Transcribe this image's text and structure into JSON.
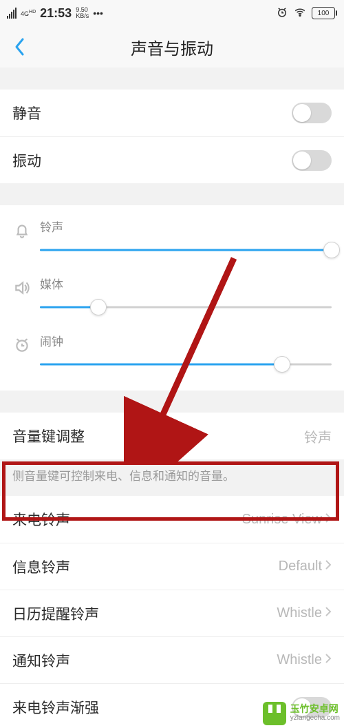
{
  "statusbar": {
    "net_gen": "4G",
    "net_sub": "HD",
    "time": "21:53",
    "speed_top": "9.50",
    "speed_unit": "KB/s",
    "dots": "•••",
    "battery": "100"
  },
  "header": {
    "title": "声音与振动"
  },
  "toggles": {
    "silent": {
      "label": "静音",
      "on": false
    },
    "vibrate": {
      "label": "振动",
      "on": false
    }
  },
  "volumes": {
    "ringtone": {
      "label": "铃声",
      "value": 100
    },
    "media": {
      "label": "媒体",
      "value": 20
    },
    "alarm": {
      "label": "闹钟",
      "value": 83
    }
  },
  "volume_key": {
    "label": "音量键调整",
    "value": "铃声",
    "hint": "侧音量键可控制来电、信息和通知的音量。"
  },
  "ringtones": {
    "incoming": {
      "label": "来电铃声",
      "value": "Sunrise View"
    },
    "message": {
      "label": "信息铃声",
      "value": "Default"
    },
    "calendar": {
      "label": "日历提醒铃声",
      "value": "Whistle"
    },
    "notify": {
      "label": "通知铃声",
      "value": "Whistle"
    },
    "gradual": {
      "label": "来电铃声渐强",
      "on": false
    }
  },
  "colors": {
    "accent": "#2aa3ef",
    "highlight": "#b01515"
  },
  "icons": {
    "back": "chevron-left",
    "alarm_status": "alarm",
    "wifi": "wifi",
    "bell": "bell",
    "speaker": "speaker",
    "clock": "alarm-clock",
    "chevron": "chevron-right"
  },
  "watermark": {
    "name": "玉竹安卓网",
    "url": "yzlangecha.com"
  }
}
